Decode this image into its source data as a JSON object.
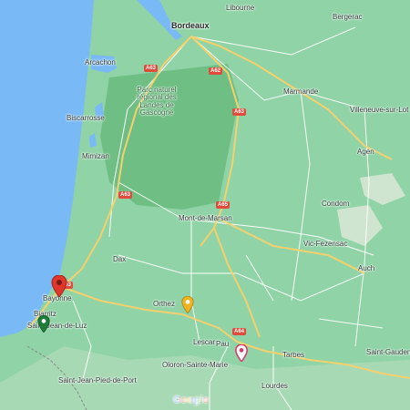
{
  "map": {
    "colors": {
      "land": "#8fd3a6",
      "forest": "#6fbf85",
      "sea": "#79b9f6",
      "road_major": "#f4d06f",
      "road_minor": "#ffffff",
      "highway_shield": "#e04b3b"
    },
    "cities": [
      {
        "name": "Bordeaux",
        "bold": true
      },
      {
        "name": "Libourne"
      },
      {
        "name": "Bergerac"
      },
      {
        "name": "Arcachon"
      },
      {
        "name": "Marmande"
      },
      {
        "name": "Villeneuve-sur-Lot"
      },
      {
        "name": "Biscarrosse"
      },
      {
        "name": "Agen"
      },
      {
        "name": "Mimizan"
      },
      {
        "name": "Condom"
      },
      {
        "name": "Mont-de-Marsan"
      },
      {
        "name": "Vic-Fezensac"
      },
      {
        "name": "Dax"
      },
      {
        "name": "Auch"
      },
      {
        "name": "Bayonne"
      },
      {
        "name": "Orthez"
      },
      {
        "name": "Biarritz"
      },
      {
        "name": "Saint-Jean-de-Luz"
      },
      {
        "name": "Lescar"
      },
      {
        "name": "Pau"
      },
      {
        "name": "Tarbes"
      },
      {
        "name": "Saint-Gaudens"
      },
      {
        "name": "Oloron-Sainte-Marie"
      },
      {
        "name": "Saint-Jean-Pied-de-Port"
      },
      {
        "name": "Lourdes"
      }
    ],
    "park_label": "Parc naturel régional des Landes de Gascogne",
    "highway_shields": [
      "A63",
      "A62",
      "A63",
      "A63",
      "A65",
      "A63",
      "A64"
    ],
    "pins": [
      {
        "name": "red-pin",
        "color": "#e0362c"
      },
      {
        "name": "green-pin",
        "color": "#1e7d3a"
      },
      {
        "name": "orange-pin",
        "color": "#f2b322"
      },
      {
        "name": "pink-pin",
        "color": "#d83a6a"
      }
    ],
    "google_logo": "Google"
  }
}
